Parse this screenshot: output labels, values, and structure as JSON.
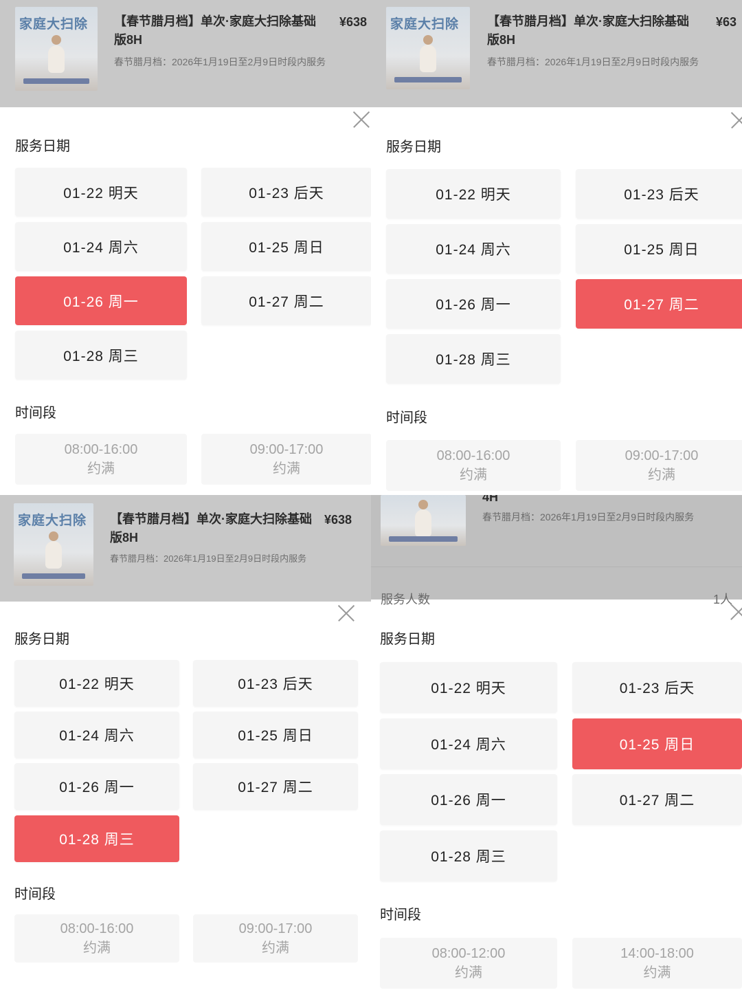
{
  "product": {
    "brand": "家庭大扫除",
    "title_line1": "【春节腊月档】单次·家庭大扫除基础",
    "title_line2": "版8H",
    "price": "¥638",
    "price_cut": "¥63",
    "subtitle": "春节腊月档：2026年1月19日至2月9日时段内服务"
  },
  "close_icon": "close-icon",
  "section_date": "服务日期",
  "section_time": "时间段",
  "dates": [
    "01-22 明天",
    "01-23 后天",
    "01-24 周六",
    "01-25 周日",
    "01-26 周一",
    "01-27 周二",
    "01-28 周三"
  ],
  "slots_8h": [
    {
      "time": "08:00-16:00",
      "status": "约满"
    },
    {
      "time": "09:00-17:00",
      "status": "约满"
    }
  ],
  "slots_4h": [
    {
      "time": "08:00-12:00",
      "status": "约满"
    },
    {
      "time": "14:00-18:00",
      "status": "约满"
    }
  ],
  "peek": {
    "title_fragment": "4H",
    "people_label": "服务人数",
    "people_value": "1人"
  },
  "panels": [
    {
      "selected_date": "01-26 周一"
    },
    {
      "selected_date": "01-27 周二"
    },
    {
      "selected_date": "01-28 周三"
    },
    {
      "selected_date": "01-25 周日"
    }
  ],
  "colors": {
    "accent": "#ef5a5e",
    "tile_bg": "#f5f5f5",
    "overlay": "#c8c8c8"
  }
}
